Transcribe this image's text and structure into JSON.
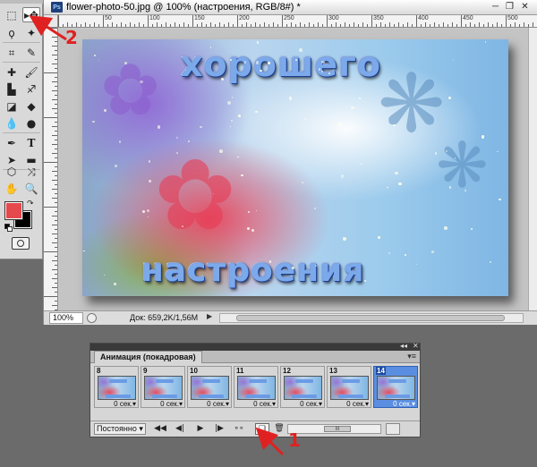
{
  "document": {
    "title": "flower-photo-50.jpg @ 100% (настроения, RGB/8#) *",
    "ps_icon": "Ps",
    "window_buttons": [
      "minimize-icon",
      "restore-icon",
      "close-icon"
    ],
    "canvas_text_top": "хорошего",
    "canvas_text_bottom": "настроения",
    "ruler_labels": [
      "50",
      "100",
      "150",
      "200",
      "250",
      "300",
      "350",
      "400",
      "450",
      "500"
    ]
  },
  "status": {
    "zoom": "100%",
    "doc_size": "Док: 659,2K/1,56M"
  },
  "tools": {
    "items": [
      "marquee-tool",
      "move-tool",
      "lasso-tool",
      "magic-wand-tool",
      "crop-tool",
      "eyedropper-tool",
      "healing-tool",
      "brush-tool",
      "stamp-tool",
      "history-brush-tool",
      "eraser-tool",
      "gradient-tool",
      "blur-tool",
      "dodge-tool",
      "pen-tool",
      "type-tool",
      "path-selection-tool",
      "shape-tool",
      "3d-rotate-tool",
      "3d-orbit-tool",
      "hand-tool",
      "zoom-tool"
    ],
    "active": "move-tool",
    "foreground_color": "#e5484d",
    "background_color": "#000000"
  },
  "animation_panel": {
    "tab": "Анимация (покадровая)",
    "frames": [
      {
        "number": "8",
        "delay": "0 сек."
      },
      {
        "number": "9",
        "delay": "0 сек."
      },
      {
        "number": "10",
        "delay": "0 сек."
      },
      {
        "number": "11",
        "delay": "0 сек."
      },
      {
        "number": "12",
        "delay": "0 сек."
      },
      {
        "number": "13",
        "delay": "0 сек."
      },
      {
        "number": "14",
        "delay": "0 сек.",
        "selected": true
      }
    ],
    "loop": "Постоянно",
    "controls": [
      "first-frame-icon",
      "prev-frame-icon",
      "play-icon",
      "next-frame-icon",
      "tween-icon",
      "duplicate-frame-icon",
      "delete-frame-icon"
    ],
    "scroll_thumb_label": "III"
  },
  "annotations": {
    "label_1": "1",
    "label_2": "2",
    "color": "#e02121"
  }
}
